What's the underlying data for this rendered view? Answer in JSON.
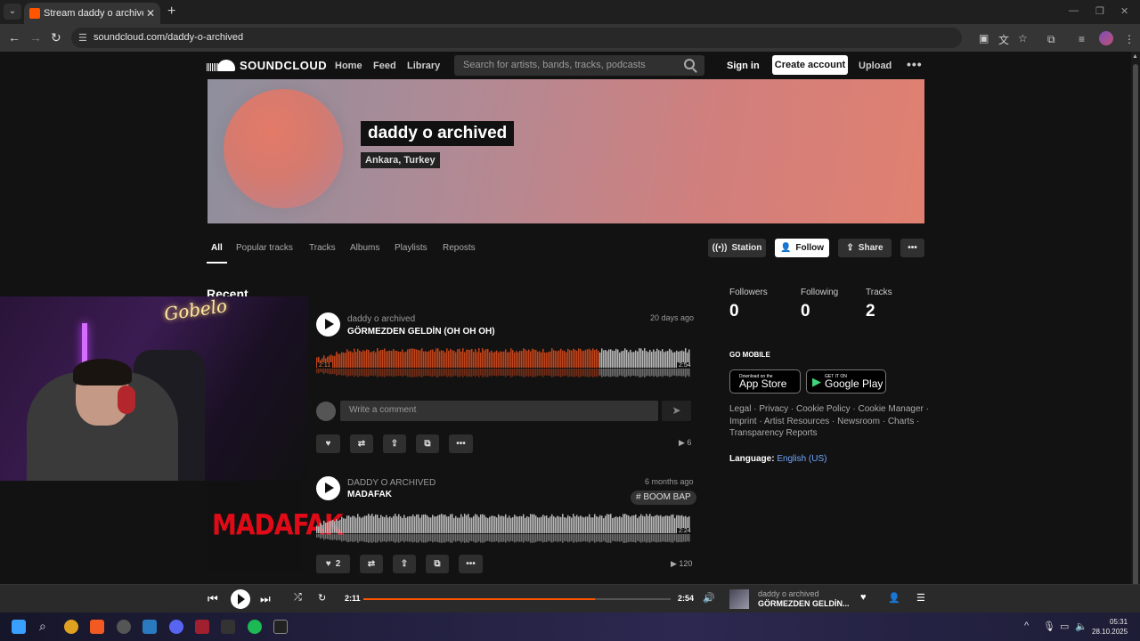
{
  "browser": {
    "tab_title": "Stream daddy o archived music",
    "url": "soundcloud.com/daddy-o-archived"
  },
  "header": {
    "logo_text": "SOUNDCLOUD",
    "nav": [
      "Home",
      "Feed",
      "Library"
    ],
    "search_placeholder": "Search for artists, bands, tracks, podcasts",
    "signin": "Sign in",
    "create_account": "Create account",
    "upload": "Upload"
  },
  "profile": {
    "name": "daddy o archived",
    "location": "Ankara, Turkey"
  },
  "tabs": [
    "All",
    "Popular tracks",
    "Tracks",
    "Albums",
    "Playlists",
    "Reposts"
  ],
  "actions": {
    "station": "Station",
    "follow": "Follow",
    "share": "Share"
  },
  "recent_title": "Recent",
  "webcam": {
    "neon_text": "Gobelo"
  },
  "tracks": [
    {
      "artist": "daddy o archived",
      "title": "GÖRMEZDEN GELDİN (OH OH OH)",
      "date": "20 days ago",
      "elapsed": "2:11",
      "duration": "2:54",
      "progress": 0.753,
      "plays": "6",
      "comment_placeholder": "Write a comment"
    },
    {
      "artist": "DADDY O ARCHIVED",
      "title": "MADAFAK",
      "date": "6 months ago",
      "tag": "# BOOM BAP",
      "duration": "2:24",
      "likes": "2",
      "plays": "120",
      "artwork_text": "MADAFAK"
    }
  ],
  "stats": [
    {
      "label": "Followers",
      "value": "0"
    },
    {
      "label": "Following",
      "value": "0"
    },
    {
      "label": "Tracks",
      "value": "2"
    }
  ],
  "go_mobile": "GO MOBILE",
  "stores": {
    "apple_small": "Download on the",
    "apple_big": "App Store",
    "google_small": "GET IT ON",
    "google_big": "Google Play"
  },
  "footer_links": "Legal · Privacy · Cookie Policy · Cookie Manager · Imprint · Artist Resources · Newsroom · Charts · Transparency Reports",
  "language": {
    "label": "Language:",
    "value": "English (US)"
  },
  "player": {
    "elapsed": "2:11",
    "duration": "2:54",
    "progress": 0.753,
    "artist": "daddy o archived",
    "title": "GÖRMEZDEN GELDİN..."
  },
  "taskbar": {
    "time": "05:31",
    "date": "28.10.2025"
  },
  "colors": {
    "accent": "#ff5500",
    "played_wave": "#c2441b",
    "wave": "#b8b8b8"
  }
}
